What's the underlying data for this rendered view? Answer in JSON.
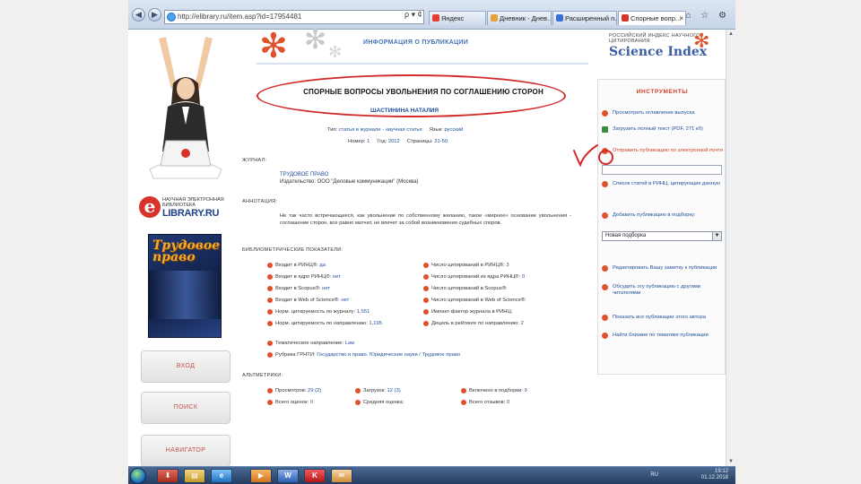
{
  "browser": {
    "address": "http://elibrary.ru/item.asp?id=17954481",
    "addr_controls": "ρ ▾ ¢",
    "tabs": [
      {
        "label": "Яндекс",
        "fav_color": "#e63b2e"
      },
      {
        "label": "Дневник - Днев...",
        "fav_color": "#e9a13b"
      },
      {
        "label": "Расширенный п...",
        "fav_color": "#3b6fd1"
      },
      {
        "label": "Спорные вопр...",
        "fav_color": "#d8332b"
      }
    ],
    "tab_close": "×",
    "tool_icons": "⌂ ☆ ⚙",
    "back_glyph": "◀",
    "forward_glyph": "▶"
  },
  "sidebar": {
    "elibrary_small": "НАУЧНАЯ ЭЛЕКТРОННАЯ БИБЛИОТЕКА",
    "elibrary_logo_letter": "e",
    "elibrary_big": "LIBRARY.RU",
    "cover_title": "Трудовое право",
    "buttons": [
      "ВХОД",
      "ПОИСК",
      "НАВИГАТОР"
    ]
  },
  "header": {
    "title": "ИНФОРМАЦИЯ О ПУБЛИКАЦИИ",
    "sci_small": "РОССИЙСКИЙ ИНДЕКС НАУЧНОГО ЦИТИРОВАНИЯ",
    "sci_big": "Science Index",
    "asterisk_glyph": "✻"
  },
  "publication": {
    "title": "СПОРНЫЕ ВОПРОСЫ УВОЛЬНЕНИЯ ПО СОГЛАШЕНИЮ СТОРОН",
    "author": "ШАСТИНИНА НАТАЛИЯ",
    "type_label": "Тип:",
    "type_value": "статья в журнале - научная статья",
    "lang_label": "Язык:",
    "lang_value": "русский",
    "number_label": "Номер:",
    "number_value": "1",
    "year_label": "Год:",
    "year_value": "2012",
    "pages_label": "Страницы:",
    "pages_value": "31-50",
    "journal_heading": "ЖУРНАЛ:",
    "journal_name": "ТРУДОВОЕ ПРАВО",
    "publisher": "Издательство: ООО \"Деловые коммуникации\" (Москва)",
    "abstract_heading": "АННОТАЦИЯ:",
    "abstract": "Не так часто встречающееся, как увольнение по собственному желанию, такое «мирное» основание увольнения - соглашение сторон, все равно матчит, не влечет за собой возникновения судебных споров.",
    "metrics_heading": "БИБЛИОМЕТРИЧЕСКИЕ ПОКАЗАТЕЛИ:",
    "metrics_left": [
      {
        "label": "Входит в РИНЦ®:",
        "value": "да"
      },
      {
        "label": "Входит в ядро РИНЦ®:",
        "value": "нет"
      },
      {
        "label": "Входит в Scopus®:",
        "value": "нет"
      },
      {
        "label": "Входит в Web of Science®:",
        "value": "нет"
      },
      {
        "label": "Норм. цитируемость по журналу:",
        "value": "1,551"
      },
      {
        "label": "Норм. цитируемость по направлению:",
        "value": "1,195"
      }
    ],
    "metrics_right": [
      {
        "label": "Число цитирований в РИНЦ®:",
        "value": "3"
      },
      {
        "label": "Число цитирований из ядра РИНЦ®:",
        "value": "0"
      },
      {
        "label": "Число цитирований в Scopus®:",
        "value": ""
      },
      {
        "label": "Число цитирований в Web of Science®:",
        "value": ""
      },
      {
        "label": "Импакт-фактор журнала в РИНЦ:",
        "value": ""
      },
      {
        "label": "Дециль в рейтинге по направлению:",
        "value": "2"
      }
    ],
    "thematic_label": "Тематическое направление:",
    "thematic_value": "Law",
    "rubric_label": "Рубрика ГРНТИ:",
    "rubric_value": "Государство и право. Юридические науки / Трудовое право",
    "altmetrics_heading": "АЛЬТМЕТРИКИ:",
    "altmetrics": [
      {
        "label": "Просмотров:",
        "value": "29 (2)"
      },
      {
        "label": "Загрузок:",
        "value": "12 (3)"
      },
      {
        "label": "Включено в подборки:",
        "value": "9"
      },
      {
        "label": "Всего оценок:",
        "value": "0"
      },
      {
        "label": "Средняя оценка:",
        "value": ""
      },
      {
        "label": "Всего отзывов:",
        "value": "0"
      }
    ]
  },
  "tools": {
    "title": "ИНСТРУМЕНТЫ",
    "items": [
      "Просмотреть оглавление выпуска",
      "Загрузить полный текст (PDF, 271 кб)",
      "Отправить публикацию по электронной почте",
      "Список статей в РИНЦ, цитирующих данную",
      "Добавить публикацию в подборку:",
      "Редактировать Вашу заметку к публикации",
      "Обсудить эту публикацию с другими читателями",
      "Показать все публикации этого автора",
      "Найти близкие по тематике публикации"
    ],
    "select_value": "Новая подборка",
    "select_arrow": "▼"
  },
  "annotation": {
    "mark": "V"
  },
  "scroll": {
    "up": "▲",
    "down": "▼"
  },
  "taskbar": {
    "icons": [
      "⬇",
      "▤",
      "e",
      "▶",
      "W",
      "K",
      "✉"
    ],
    "lang": "RU",
    "time": "19:12",
    "date": "01.12.2018"
  },
  "colors": {
    "accent": "#d0402b",
    "link": "#1f4e9a",
    "annotation": "#d22a2a"
  }
}
